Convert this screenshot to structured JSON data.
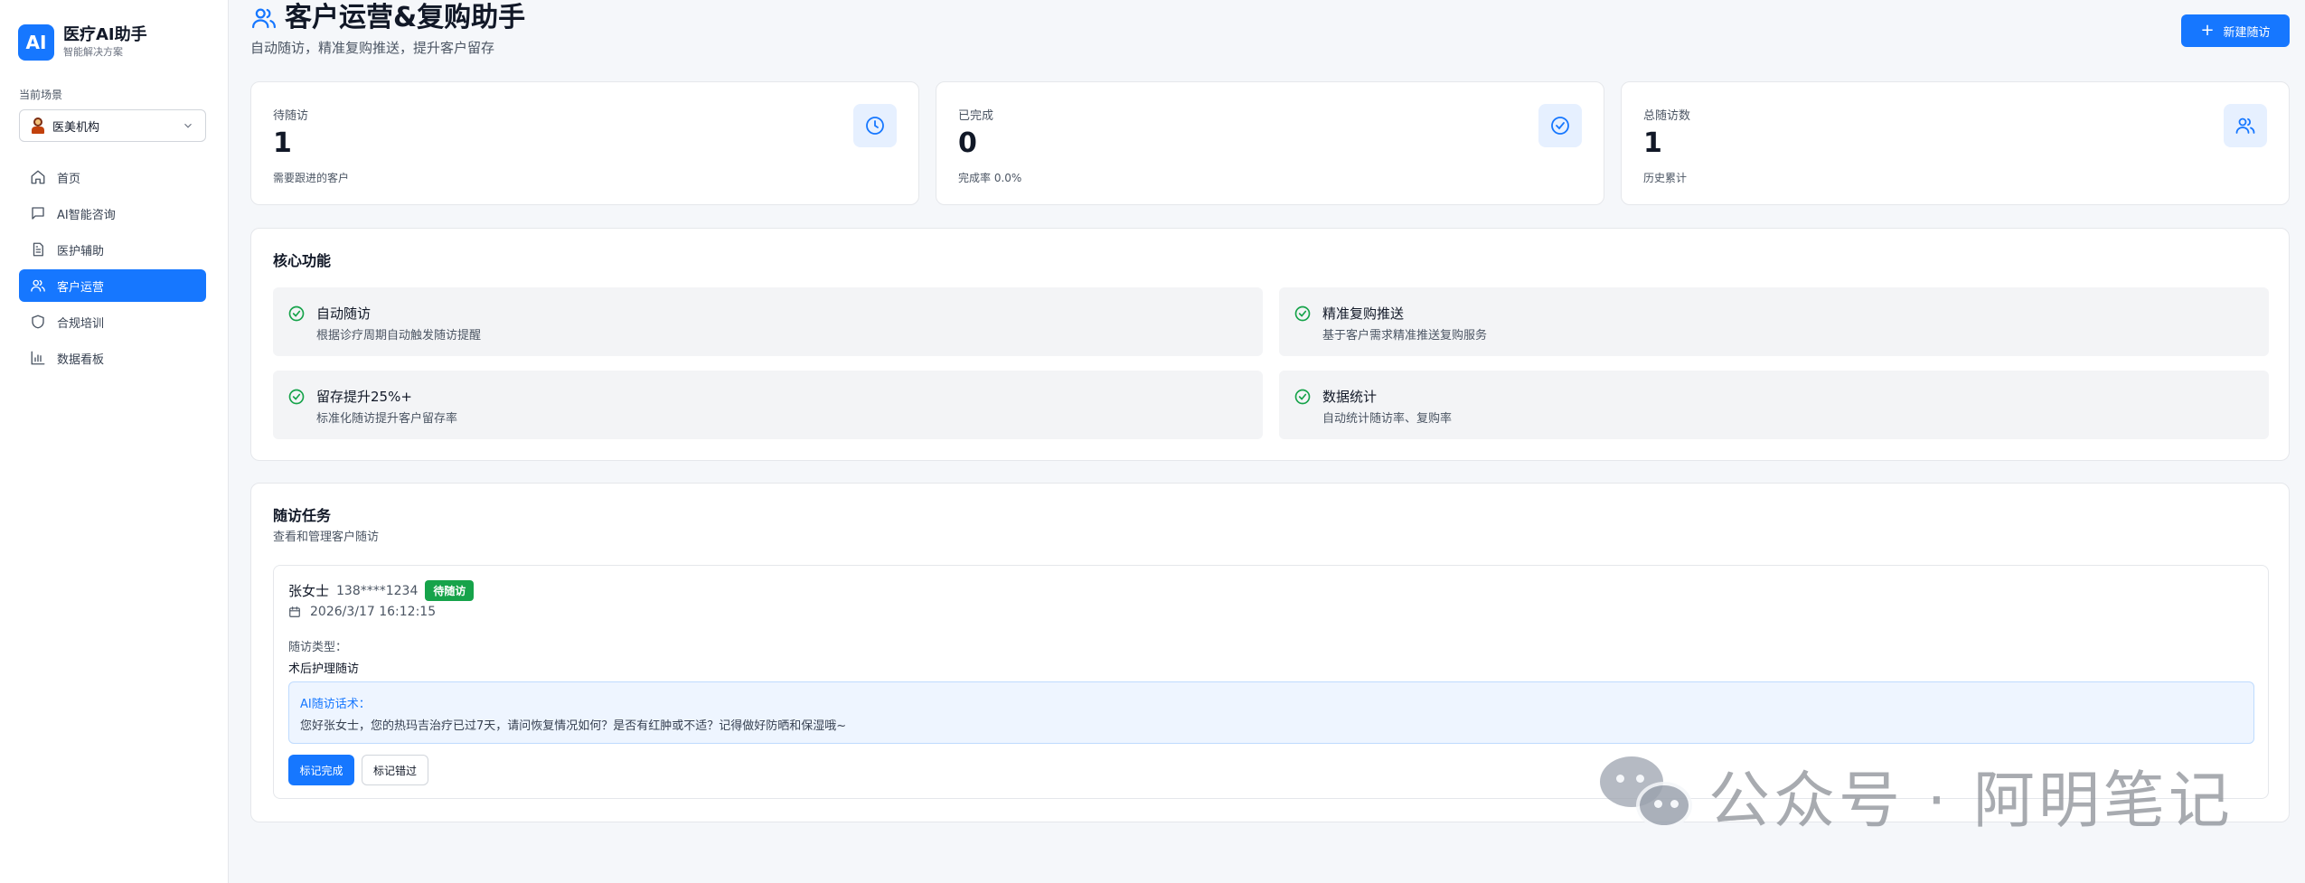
{
  "sidebar": {
    "logo_text": "AI",
    "brand_title": "医疗AI助手",
    "brand_subtitle": "智能解决方案",
    "scene_label": "当前场景",
    "scene_value": "医美机构",
    "nav": [
      {
        "label": "首页",
        "icon": "home-icon"
      },
      {
        "label": "AI智能咨询",
        "icon": "chat-icon"
      },
      {
        "label": "医护辅助",
        "icon": "document-icon"
      },
      {
        "label": "客户运营",
        "icon": "users-icon",
        "active": true
      },
      {
        "label": "合规培训",
        "icon": "shield-icon"
      },
      {
        "label": "数据看板",
        "icon": "bar-chart-icon"
      }
    ]
  },
  "header": {
    "title": "客户运营&复购助手",
    "subtitle": "自动随访，精准复购推送，提升客户留存",
    "new_button": "新建随访"
  },
  "stats": [
    {
      "label": "待随访",
      "value": "1",
      "note": "需要跟进的客户",
      "icon": "clock-icon"
    },
    {
      "label": "已完成",
      "value": "0",
      "note": "完成率 0.0%",
      "icon": "check-circle-icon"
    },
    {
      "label": "总随访数",
      "value": "1",
      "note": "历史累计",
      "icon": "users-icon"
    }
  ],
  "core": {
    "title": "核心功能",
    "features": [
      {
        "title": "自动随访",
        "desc": "根据诊疗周期自动触发随访提醒"
      },
      {
        "title": "精准复购推送",
        "desc": "基于客户需求精准推送复购服务"
      },
      {
        "title": "留存提升25%+",
        "desc": "标准化随访提升客户留存率"
      },
      {
        "title": "数据统计",
        "desc": "自动统计随访率、复购率"
      }
    ]
  },
  "tasks": {
    "title": "随访任务",
    "subtitle": "查看和管理客户随访",
    "items": [
      {
        "name": "张女士",
        "phone": "138****1234",
        "status": "待随访",
        "time": "2026/3/17 16:12:15",
        "type_label": "随访类型：",
        "type": "术后护理随访",
        "ai_label": "AI随访话术：",
        "ai_text": "您好张女士，您的热玛吉治疗已过7天，请问恢复情况如何？是否有红肿或不适？记得做好防晒和保湿哦~",
        "complete_button": "标记完成",
        "miss_button": "标记错过"
      }
    ]
  },
  "watermark": "公众号 · 阿明笔记",
  "colors": {
    "primary": "#1677ff",
    "success": "#16a34a",
    "background": "#f5f7fa"
  }
}
